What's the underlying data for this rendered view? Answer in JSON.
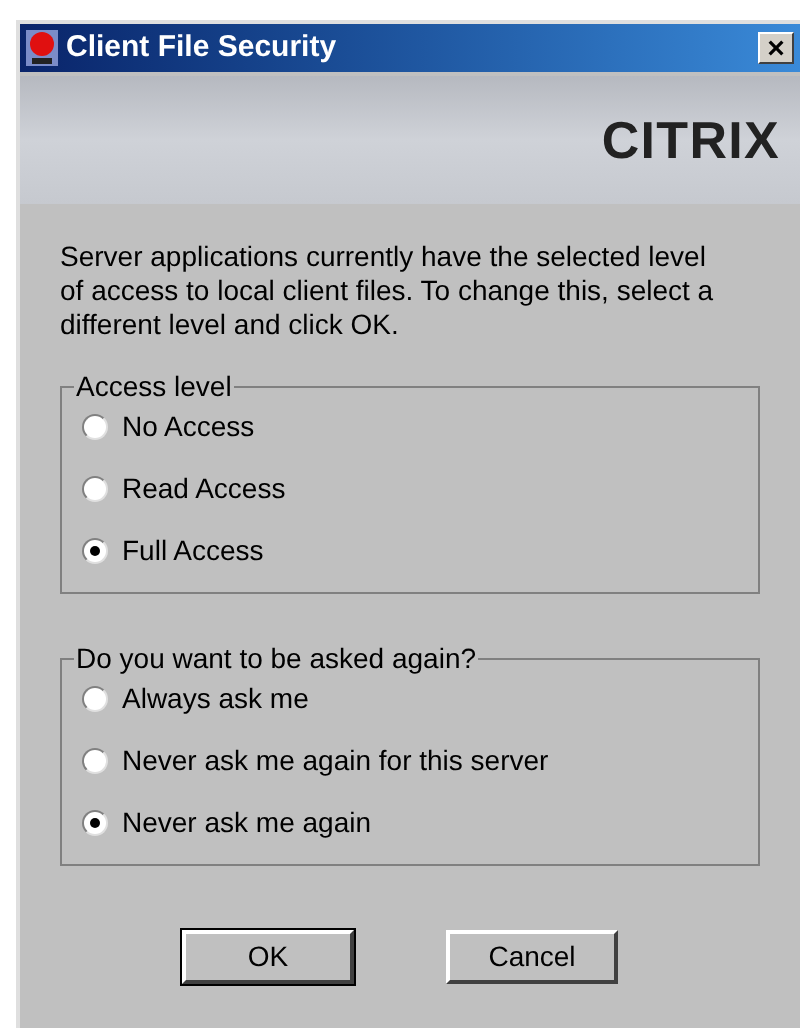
{
  "window": {
    "title": "Client File Security",
    "close": "×"
  },
  "banner": {
    "logo": "CITRIX"
  },
  "message": "Server applications currently have the selected level of access to local client files. To change this, select a different level and click OK.",
  "groups": [
    {
      "title": "Access level",
      "options": [
        {
          "label": "No Access",
          "selected": false
        },
        {
          "label": "Read Access",
          "selected": false
        },
        {
          "label": "Full Access",
          "selected": true
        }
      ]
    },
    {
      "title": "Do you want to be asked again?",
      "options": [
        {
          "label": "Always ask me",
          "selected": false
        },
        {
          "label": "Never ask me again for this server",
          "selected": false
        },
        {
          "label": "Never ask me again",
          "selected": true
        }
      ]
    }
  ],
  "buttons": [
    {
      "label": "OK",
      "default": true
    },
    {
      "label": "Cancel",
      "default": false
    }
  ]
}
